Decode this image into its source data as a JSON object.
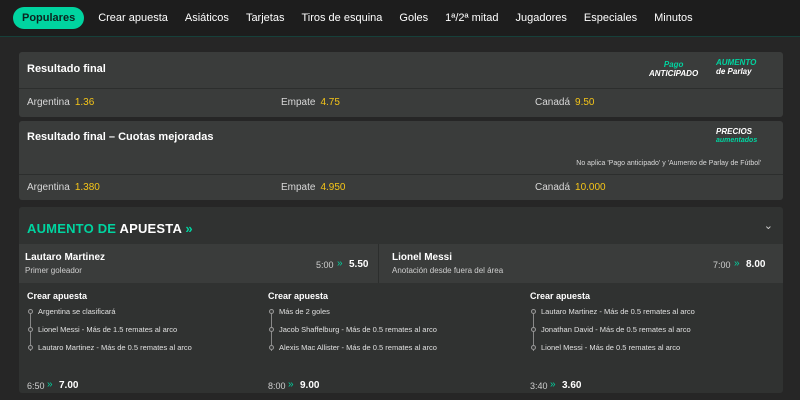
{
  "tabs": [
    "Populares",
    "Crear apuesta",
    "Asiáticos",
    "Tarjetas",
    "Tiros de esquina",
    "Goles",
    "1ª/2ª mitad",
    "Jugadores",
    "Especiales",
    "Minutos"
  ],
  "market1": {
    "title": "Resultado final",
    "promo1": {
      "line1": "Pago",
      "line2": "ANTICIPADO"
    },
    "promo2": {
      "line1": "AUMENTO",
      "line2": "de Parlay"
    },
    "outcomes": [
      {
        "label": "Argentina",
        "odds": "1.36"
      },
      {
        "label": "Empate",
        "odds": "4.75"
      },
      {
        "label": "Canadá",
        "odds": "9.50"
      }
    ]
  },
  "market2": {
    "title": "Resultado final – Cuotas mejoradas",
    "promo": {
      "line1": "PRECIOS",
      "line2": "aumentados"
    },
    "note": "No aplica 'Pago anticipado' y 'Aumento de Parlay de Fútbol'",
    "outcomes": [
      {
        "label": "Argentina",
        "odds": "1.380"
      },
      {
        "label": "Empate",
        "odds": "4.950"
      },
      {
        "label": "Canadá",
        "odds": "10.000"
      }
    ]
  },
  "boost": {
    "title_part1": "AUMENTO DE",
    "title_part2": "APUESTA",
    "players": [
      {
        "name": "Lautaro Martinez",
        "market": "Primer goleador",
        "old": "5:00",
        "new": "5.50"
      },
      {
        "name": "Lionel Messi",
        "market": "Anotación desde fuera del área",
        "old": "7:00",
        "new": "8.00"
      }
    ],
    "builders": [
      {
        "title": "Crear apuesta",
        "legs": [
          "Argentina se clasificará",
          "Lionel Messi - Más de 1.5 remates al arco",
          "Lautaro Martinez - Más de 0.5 remates al arco"
        ],
        "old": "6:50",
        "new": "7.00"
      },
      {
        "title": "Crear apuesta",
        "legs": [
          "Más de 2 goles",
          "Jacob Shaffelburg - Más de 0.5 remates al arco",
          "Alexis Mac Allister - Más de 0.5 remates al arco"
        ],
        "old": "8:00",
        "new": "9.00"
      },
      {
        "title": "Crear apuesta",
        "legs": [
          "Lautaro Martinez - Más de 0.5 remates al arco",
          "Jonathan David - Más de 0.5 remates al arco",
          "Lionel Messi - Más de 0.5 remates al arco"
        ],
        "old": "3:40",
        "new": "3.60"
      }
    ]
  },
  "colors": {
    "accent": "#00d4a0",
    "odds": "#f5c518",
    "card": "#3a3c3b",
    "background": "#262626"
  }
}
